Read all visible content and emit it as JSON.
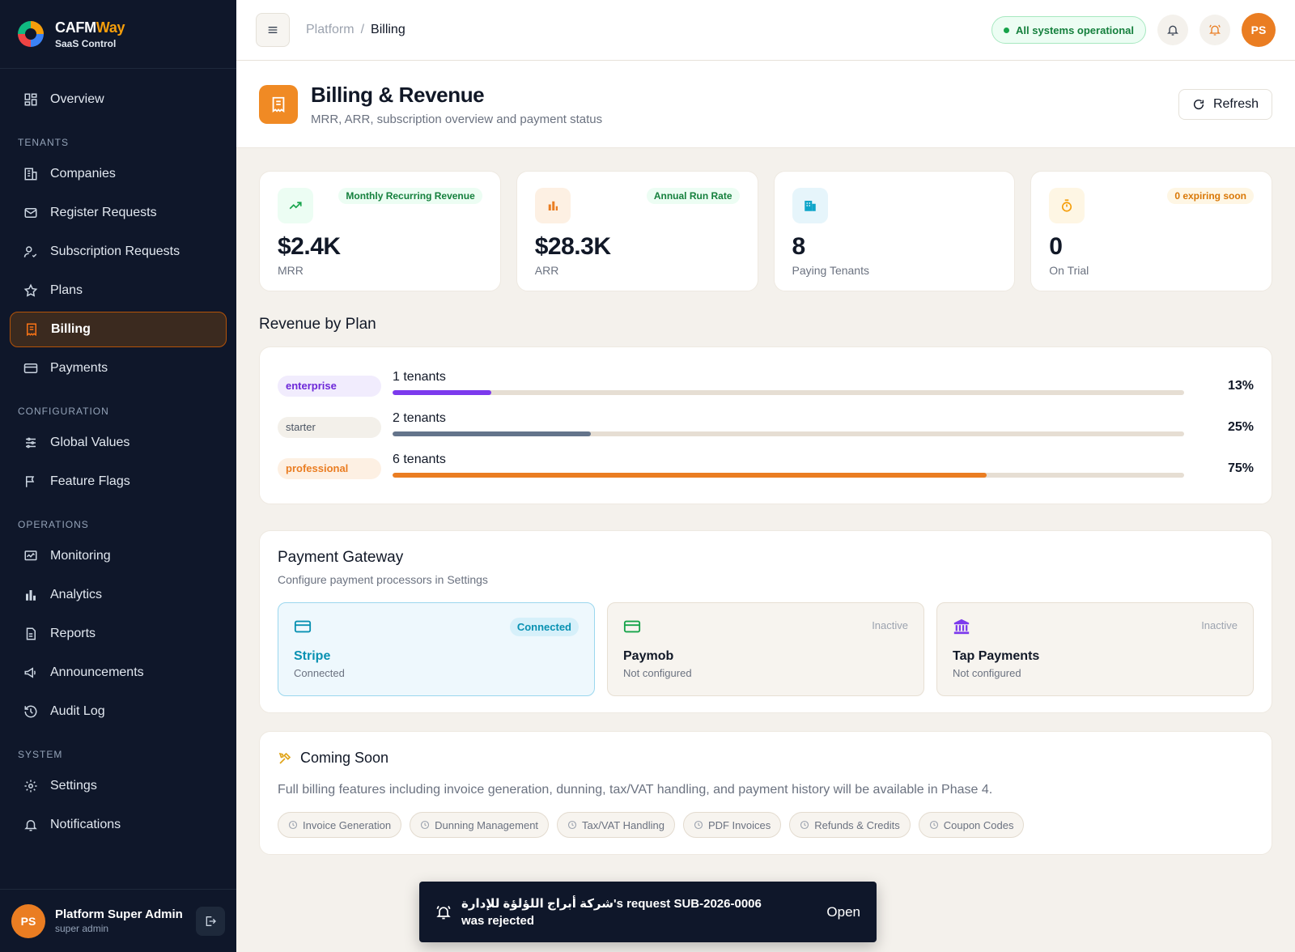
{
  "brand": {
    "name_main": "CAFM",
    "name_accent": "Way",
    "subtitle": "SaaS Control"
  },
  "sidebar": {
    "overview": "Overview",
    "sections": {
      "tenants": "TENANTS",
      "configuration": "CONFIGURATION",
      "operations": "OPERATIONS",
      "system": "SYSTEM"
    },
    "items": {
      "companies": "Companies",
      "register_requests": "Register Requests",
      "subscription_requests": "Subscription Requests",
      "plans": "Plans",
      "billing": "Billing",
      "payments": "Payments",
      "global_values": "Global Values",
      "feature_flags": "Feature Flags",
      "monitoring": "Monitoring",
      "analytics": "Analytics",
      "reports": "Reports",
      "announcements": "Announcements",
      "audit_log": "Audit Log",
      "settings": "Settings",
      "notifications": "Notifications"
    },
    "active_item": "billing",
    "user": {
      "initials": "PS",
      "name": "Platform Super Admin",
      "role": "super admin"
    }
  },
  "topbar": {
    "breadcrumb": [
      "Platform",
      "/",
      "Billing"
    ],
    "status": "All systems operational",
    "avatar_initials": "PS"
  },
  "page": {
    "title": "Billing & Revenue",
    "subtitle": "MRR, ARR, subscription overview and payment status",
    "refresh_label": "Refresh"
  },
  "stats": [
    {
      "tag": "Monthly Recurring Revenue",
      "value": "$2.4K",
      "label": "MRR",
      "icon": "trending-up-icon"
    },
    {
      "tag": "Annual Run Rate",
      "value": "$28.3K",
      "label": "ARR",
      "icon": "bar-chart-icon"
    },
    {
      "tag": "",
      "value": "8",
      "label": "Paying Tenants",
      "icon": "building-icon"
    },
    {
      "tag": "0 expiring soon",
      "value": "0",
      "label": "On Trial",
      "icon": "timer-icon"
    }
  ],
  "revenue_by_plan": {
    "title": "Revenue by Plan",
    "rows": [
      {
        "plan": "enterprise",
        "tenants": "1 tenants",
        "percent": "13%",
        "fraction": 0.125,
        "color": "#7c3aed"
      },
      {
        "plan": "starter",
        "tenants": "2 tenants",
        "percent": "25%",
        "fraction": 0.25,
        "color": "#64748b"
      },
      {
        "plan": "professional",
        "tenants": "6 tenants",
        "percent": "75%",
        "fraction": 0.75,
        "color": "#ea7d22"
      }
    ]
  },
  "gateway": {
    "title": "Payment Gateway",
    "subtitle": "Configure payment processors in Settings",
    "items": [
      {
        "name": "Stripe",
        "status": "Connected",
        "note": "Connected",
        "icon": "credit-card-icon"
      },
      {
        "name": "Paymob",
        "status": "Inactive",
        "note": "Not configured",
        "icon": "credit-card-icon"
      },
      {
        "name": "Tap Payments",
        "status": "Inactive",
        "note": "Not configured",
        "icon": "bank-icon"
      }
    ]
  },
  "coming_soon": {
    "title": "Coming Soon",
    "text": "Full billing features including invoice generation, dunning, tax/VAT handling, and payment history will be available in Phase 4.",
    "chips": [
      "Invoice Generation",
      "Dunning Management",
      "Tax/VAT Handling",
      "PDF Invoices",
      "Refunds & Credits",
      "Coupon Codes"
    ]
  },
  "toast": {
    "message": "شركة أبراج اللؤلؤة للإدارة's request SUB-2026-0006 was rejected",
    "action": "Open"
  }
}
